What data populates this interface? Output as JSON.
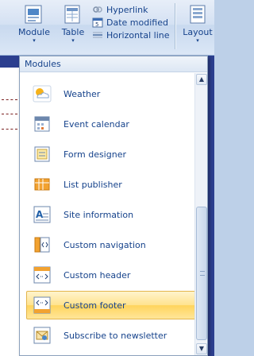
{
  "ribbon": {
    "module_label": "Module",
    "table_label": "Table",
    "layout_label": "Layout",
    "caret": "▾",
    "small_items": [
      {
        "label": "Hyperlink",
        "icon": "hyperlink-icon"
      },
      {
        "label": "Date modified",
        "icon": "date-modified-icon"
      },
      {
        "label": "Horizontal line",
        "icon": "horizontal-line-icon"
      }
    ]
  },
  "panel": {
    "title": "Modules",
    "scroll_up": "▲",
    "scroll_down": "▼",
    "items": [
      {
        "label": "Weather",
        "icon": "weather-icon",
        "selected": false
      },
      {
        "label": "Event calendar",
        "icon": "event-calendar-icon",
        "selected": false
      },
      {
        "label": "Form designer",
        "icon": "form-designer-icon",
        "selected": false
      },
      {
        "label": "List publisher",
        "icon": "list-publisher-icon",
        "selected": false
      },
      {
        "label": "Site information",
        "icon": "site-information-icon",
        "selected": false
      },
      {
        "label": "Custom navigation",
        "icon": "custom-navigation-icon",
        "selected": false
      },
      {
        "label": "Custom header",
        "icon": "custom-header-icon",
        "selected": false
      },
      {
        "label": "Custom footer",
        "icon": "custom-footer-icon",
        "selected": true
      },
      {
        "label": "Subscribe to newsletter",
        "icon": "subscribe-newsletter-icon",
        "selected": false
      }
    ]
  },
  "colors": {
    "accent_text": "#15428b",
    "selected_bg": "#ffd45c",
    "doc_bg": "#2c3f8f"
  }
}
